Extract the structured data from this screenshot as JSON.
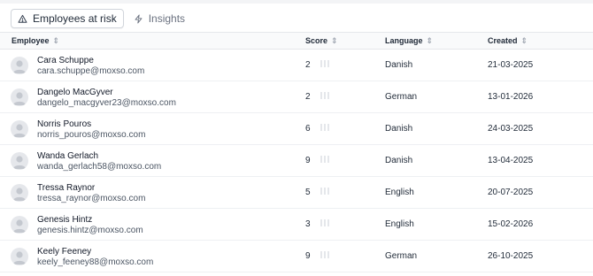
{
  "tabs": [
    {
      "label": "Employees at risk",
      "icon": "warning-triangle-icon",
      "active": true
    },
    {
      "label": "Insights",
      "icon": "lightning-icon",
      "active": false
    }
  ],
  "table": {
    "headers": {
      "employee": "Employee",
      "score": "Score",
      "language": "Language",
      "created": "Created"
    },
    "rows": [
      {
        "name": "Cara Schuppe",
        "email": "cara.schuppe@moxso.com",
        "score": "2",
        "language": "Danish",
        "created": "21-03-2025"
      },
      {
        "name": "Dangelo MacGyver",
        "email": "dangelo_macgyver23@moxso.com",
        "score": "2",
        "language": "German",
        "created": "13-01-2026"
      },
      {
        "name": "Norris Pouros",
        "email": "norris_pouros@moxso.com",
        "score": "6",
        "language": "Danish",
        "created": "24-03-2025"
      },
      {
        "name": "Wanda Gerlach",
        "email": "wanda_gerlach58@moxso.com",
        "score": "9",
        "language": "Danish",
        "created": "13-04-2025"
      },
      {
        "name": "Tressa Raynor",
        "email": "tressa_raynor@moxso.com",
        "score": "5",
        "language": "English",
        "created": "20-07-2025"
      },
      {
        "name": "Genesis Hintz",
        "email": "genesis.hintz@moxso.com",
        "score": "3",
        "language": "English",
        "created": "15-02-2026"
      },
      {
        "name": "Keely Feeney",
        "email": "keely_feeney88@moxso.com",
        "score": "9",
        "language": "German",
        "created": "26-10-2025"
      }
    ]
  },
  "colors": {
    "text": "#111827",
    "email": "#4b5563",
    "border": "#e5e7eb",
    "header_bg": "#f9fafb"
  }
}
